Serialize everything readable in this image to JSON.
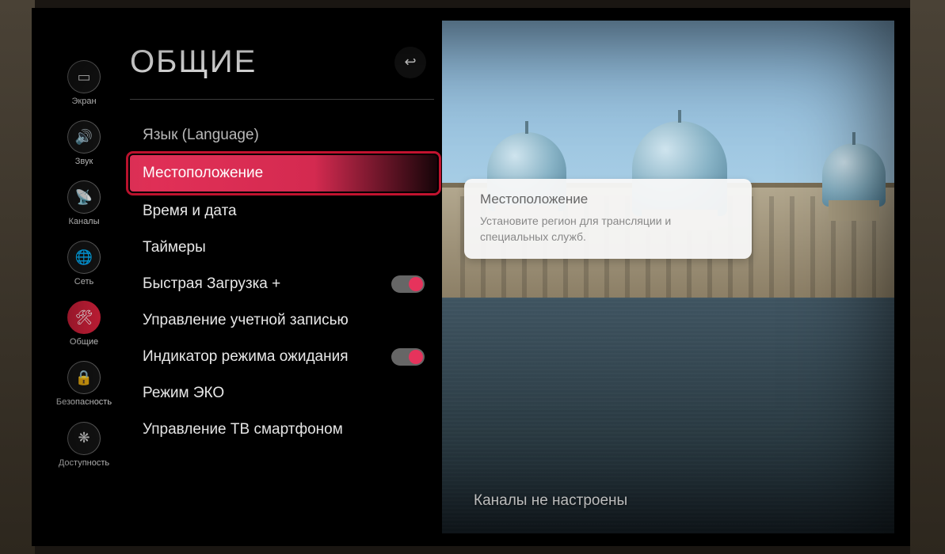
{
  "sidebar": {
    "items": [
      {
        "label": "Экран",
        "icon": "▭"
      },
      {
        "label": "Звук",
        "icon": "🔊"
      },
      {
        "label": "Каналы",
        "icon": "📡"
      },
      {
        "label": "Сеть",
        "icon": "🌐"
      },
      {
        "label": "Общие",
        "icon": "🛠"
      },
      {
        "label": "Безопасность",
        "icon": "🔒"
      },
      {
        "label": "Доступность",
        "icon": "❋"
      }
    ],
    "active_index": 4
  },
  "panel": {
    "title": "ОБЩИЕ",
    "back_aria": "Назад",
    "items": [
      {
        "label": "Язык (Language)",
        "type": "nav",
        "cut": true
      },
      {
        "label": "Местоположение",
        "type": "nav",
        "selected": true
      },
      {
        "label": "Время и дата",
        "type": "nav"
      },
      {
        "label": "Таймеры",
        "type": "nav"
      },
      {
        "label": "Быстрая Загрузка +",
        "type": "toggle",
        "value": true
      },
      {
        "label": "Управление учетной записью",
        "type": "nav"
      },
      {
        "label": "Индикатор режима ожидания",
        "type": "toggle",
        "value": true
      },
      {
        "label": "Режим ЭКО",
        "type": "nav"
      },
      {
        "label": "Управление ТВ смартфоном",
        "type": "nav"
      }
    ]
  },
  "info": {
    "title": "Местоположение",
    "description": "Установите регион для трансляции и специальных служб."
  },
  "status": {
    "message": "Каналы не настроены"
  },
  "colors": {
    "accent": "#e33158"
  }
}
